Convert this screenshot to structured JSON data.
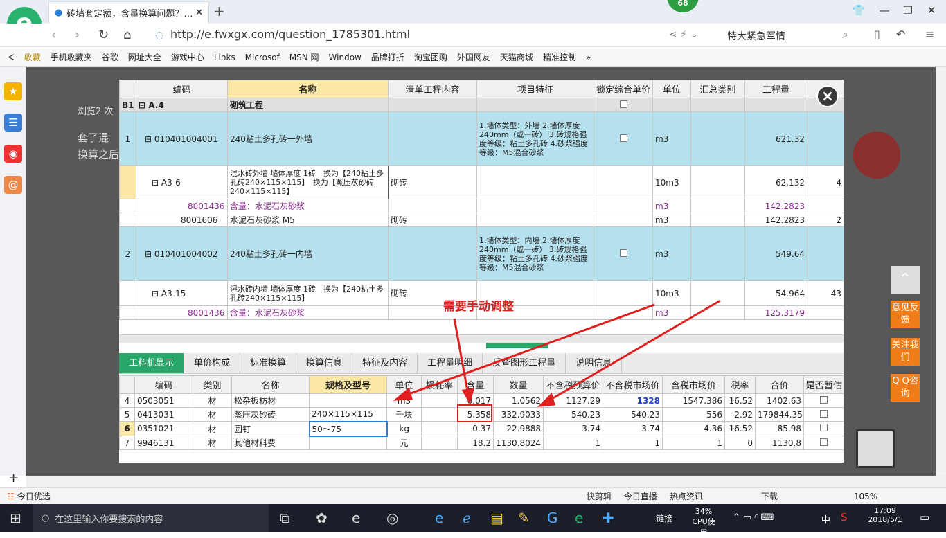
{
  "browser": {
    "logo": "e",
    "tab_title": "砖墙套定额，含量换算问题？_广",
    "badge": "68",
    "url": "http://e.fwxgx.com/question_1785301.html",
    "search_text": "特大紧急军情",
    "favorites": [
      "收藏",
      "手机收藏夹",
      "谷歌",
      "网址大全",
      "游戏中心",
      "Links",
      "Microsof",
      "MSN 网",
      "Window",
      "品牌打折",
      "淘宝团购",
      "外国网友",
      "天猫商城",
      "精准控制"
    ]
  },
  "page": {
    "behind_text1": "套了混",
    "behind_text2": "换算之后",
    "behind_text3": "浏览2 次"
  },
  "side_buttons": {
    "feedback": "意见反馈",
    "follow": "关注我们",
    "qq": "Q Q咨询"
  },
  "grid_top": {
    "headers": [
      "",
      "编码",
      "名称",
      "清单工程内容",
      "项目特征",
      "锁定综合单价",
      "单位",
      "汇总类别",
      "工程量",
      ""
    ],
    "section": {
      "id": "B1",
      "code": "A.4",
      "name": "砌筑工程"
    },
    "rows": [
      {
        "no": "1",
        "code": "010401004001",
        "name": "240粘土多孔砖一外墙",
        "content": "",
        "feature": "1.墙体类型：外墙 2.墙体厚度240mm（或一砖） 3.砖规格强度等级：粘土多孔砖 4.砂浆强度等级：M5混合砂浆",
        "unit": "m3",
        "qty": "621.32",
        "extra": ""
      },
      {
        "no": "",
        "code": "A3-6",
        "name": "混水砖外墙 墙体厚度 1砖　换为【240粘土多孔砖240×115×115】　换为【蒸压灰砂砖240×115×115】",
        "content": "砌砖",
        "feature": "",
        "unit": "10m3",
        "qty": "62.132",
        "extra": "4"
      },
      {
        "no": "",
        "code": "8001436",
        "name": "含量：水泥石灰砂浆",
        "content": "",
        "feature": "",
        "unit": "m3",
        "qty": "142.2823",
        "extra": ""
      },
      {
        "no": "",
        "code": "8001606",
        "name": "水泥石灰砂浆 M5",
        "content": "砌砖",
        "feature": "",
        "unit": "m3",
        "qty": "142.2823",
        "extra": "2"
      },
      {
        "no": "2",
        "code": "010401004002",
        "name": "240粘土多孔砖一内墙",
        "content": "",
        "feature": "1.墙体类型：内墙 2.墙体厚度240mm（或一砖） 3.砖规格强度等级：粘土多孔砖 4.砂浆强度等级：M5混合砂浆",
        "unit": "m3",
        "qty": "549.64",
        "extra": ""
      },
      {
        "no": "",
        "code": "A3-15",
        "name": "混水砖内墙 墙体厚度 1砖　换为【240粘土多孔砖240×115×115】",
        "content": "砌砖",
        "feature": "",
        "unit": "10m3",
        "qty": "54.964",
        "extra": "43"
      },
      {
        "no": "",
        "code": "8001436",
        "name": "含量：水泥石灰砂浆",
        "content": "",
        "feature": "",
        "unit": "m3",
        "qty": "125.3179",
        "extra": ""
      }
    ]
  },
  "bottom_tabs": [
    "工料机显示",
    "单价构成",
    "标准换算",
    "换算信息",
    "特征及内容",
    "工程量明细",
    "反查图形工程量",
    "说明信息"
  ],
  "grid_bottom": {
    "headers": [
      "",
      "编码",
      "类别",
      "名称",
      "规格及型号",
      "单位",
      "损耗率",
      "含量",
      "数量",
      "不含税预算价",
      "不含税市场价",
      "含税市场价",
      "税率",
      "合价",
      "是否暂估"
    ],
    "rows": [
      {
        "no": "4",
        "code": "0503051",
        "type": "材",
        "name": "松杂板枋材",
        "spec": "",
        "unit": "m3",
        "loss": "",
        "content": "0.017",
        "qty": "1.0562",
        "p1": "1127.29",
        "p2": "1328",
        "p3": "1547.386",
        "tax": "16.52",
        "total": "1402.63"
      },
      {
        "no": "5",
        "code": "0413031",
        "type": "材",
        "name": "蒸压灰砂砖",
        "spec": "240×115×115",
        "unit": "千块",
        "loss": "",
        "content": "5.358",
        "qty": "332.9033",
        "p1": "540.23",
        "p2": "540.23",
        "p3": "556",
        "tax": "2.92",
        "total": "179844.35"
      },
      {
        "no": "6",
        "code": "0351021",
        "type": "材",
        "name": "圆钉",
        "spec": "50～75",
        "unit": "kg",
        "loss": "",
        "content": "0.37",
        "qty": "22.9888",
        "p1": "3.74",
        "p2": "3.74",
        "p3": "4.36",
        "tax": "16.52",
        "total": "85.98"
      },
      {
        "no": "7",
        "code": "9946131",
        "type": "材",
        "name": "其他材料费",
        "spec": "",
        "unit": "元",
        "loss": "",
        "content": "18.2",
        "qty": "1130.8024",
        "p1": "1",
        "p2": "1",
        "p3": "1",
        "tax": "0",
        "total": "1130.8"
      }
    ]
  },
  "annotation": "需要手动调整",
  "statusbar": {
    "left": "今日优选",
    "items": [
      "快剪辑",
      "今日直播",
      "热点资讯",
      "下载"
    ],
    "zoom": "105%"
  },
  "taskbar": {
    "search_placeholder": "在这里输入你要搜索的内容",
    "link": "链接",
    "cpu_pct": "34%",
    "cpu_label": "CPU使用",
    "lang": "中",
    "time": "17:09",
    "date": "2018/5/1"
  },
  "colors": {
    "header_yellow": "#fbe7a6",
    "row_blue": "#b5e1ef",
    "tab_green": "#27a86a",
    "annot_red": "#d0221f"
  }
}
